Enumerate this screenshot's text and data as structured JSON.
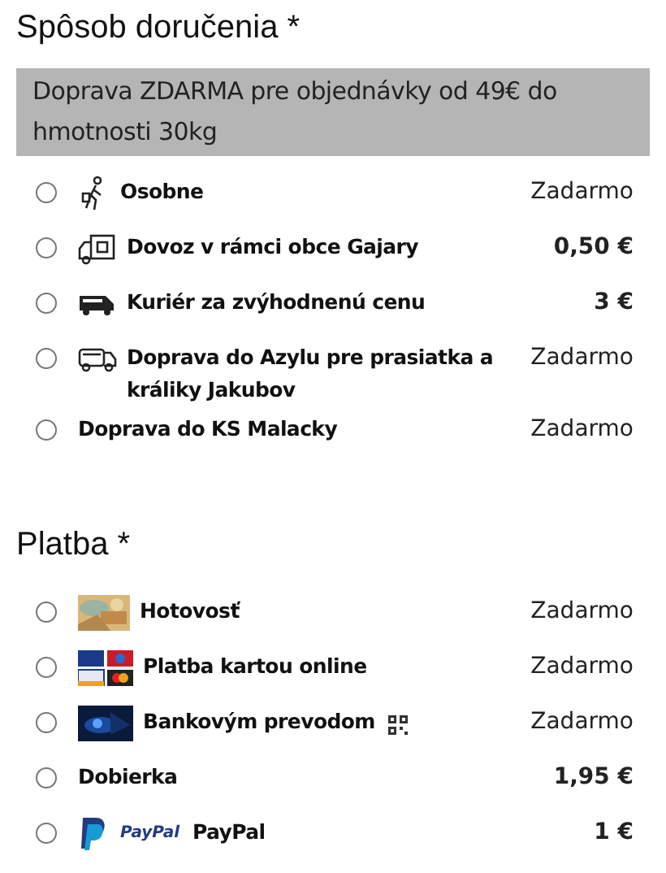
{
  "shipping": {
    "title": "Spôsob doručenia *",
    "notice": "Doprava ZDARMA pre objednávky od 49€ do hmotnosti 30kg",
    "options": [
      {
        "kind": "walker",
        "label": "Osobne",
        "price": "Zadarmo",
        "emphasized": false,
        "selected": false
      },
      {
        "kind": "delivery-van",
        "label": "Dovoz v rámci obce Gajary",
        "price": "0,50 €",
        "emphasized": true,
        "selected": false
      },
      {
        "kind": "van",
        "label": "Kuriér za zvýhodnenú cenu",
        "price": "3 €",
        "emphasized": true,
        "selected": false
      },
      {
        "kind": "truck",
        "label": "Doprava do Azylu pre prasiatka a králiky Jakubov",
        "price": "Zadarmo",
        "emphasized": false,
        "selected": false
      },
      {
        "kind": "none",
        "label": "Doprava do KS Malacky",
        "price": "Zadarmo",
        "emphasized": false,
        "selected": false
      }
    ]
  },
  "payment": {
    "title": "Platba *",
    "options": [
      {
        "kind": "cash",
        "label": "Hotovosť",
        "price": "Zadarmo",
        "emphasized": false,
        "selected": false,
        "qr": false
      },
      {
        "kind": "cards",
        "label": "Platba kartou online",
        "price": "Zadarmo",
        "emphasized": false,
        "selected": false,
        "qr": false
      },
      {
        "kind": "bank",
        "label": "Bankovým prevodom",
        "price": "Zadarmo",
        "emphasized": false,
        "selected": false,
        "qr": true
      },
      {
        "kind": "none",
        "label": "Dobierka",
        "price": "1,95 €",
        "emphasized": true,
        "selected": false,
        "qr": false
      },
      {
        "kind": "paypal",
        "label": "PayPal",
        "logo_text": "PayPal",
        "price": "1 €",
        "emphasized": true,
        "selected": false,
        "qr": false
      }
    ]
  }
}
